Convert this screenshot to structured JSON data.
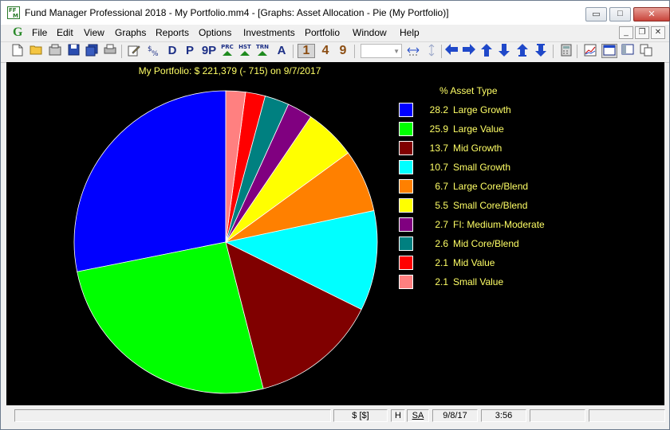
{
  "window": {
    "title": "Fund Manager Professional 2018 - My Portfolio.mm4 - [Graphs: Asset Allocation - Pie (My Portfolio)]",
    "icon_text_top": "FF",
    "icon_text_bottom": "M",
    "minimize_glyph": "▭",
    "maximize_glyph": "□",
    "close_glyph": "✕"
  },
  "menu": {
    "logo": "G",
    "items": [
      "File",
      "Edit",
      "View",
      "Graphs",
      "Reports",
      "Options",
      "Investments",
      "Portfolio",
      "Window",
      "Help"
    ],
    "mdi_minimize": "_",
    "mdi_restore": "❐",
    "mdi_close": "✕"
  },
  "toolbar": {
    "text_buttons": [
      "D",
      "P",
      "9P"
    ],
    "small_labels": [
      "PRC",
      "HST",
      "TRN"
    ],
    "a_button": "A",
    "period_buttons": [
      "1",
      "4",
      "9"
    ],
    "combo_value": ""
  },
  "chart_data": {
    "type": "pie",
    "title": "My Portfolio: $ 221,379 (- 715) on 9/7/2017",
    "legend_header": "%  Asset Type",
    "slices": [
      {
        "label": "Large Growth",
        "value": 28.2,
        "color": "#0000ff"
      },
      {
        "label": "Large Value",
        "value": 25.9,
        "color": "#00ff00"
      },
      {
        "label": "Mid Growth",
        "value": 13.7,
        "color": "#800000"
      },
      {
        "label": "Small Growth",
        "value": 10.7,
        "color": "#00ffff"
      },
      {
        "label": "Large Core/Blend",
        "value": 6.7,
        "color": "#ff8000"
      },
      {
        "label": "Small Core/Blend",
        "value": 5.5,
        "color": "#ffff00"
      },
      {
        "label": "FI: Medium-Moderate",
        "value": 2.7,
        "color": "#800080"
      },
      {
        "label": "Mid Core/Blend",
        "value": 2.6,
        "color": "#008080"
      },
      {
        "label": "Mid Value",
        "value": 2.1,
        "color": "#ff0000"
      },
      {
        "label": "Small Value",
        "value": 2.1,
        "color": "#ff8080"
      }
    ]
  },
  "status": {
    "currency": "$ [$]",
    "h": "H",
    "sa": "SA",
    "date": "9/8/17",
    "time": "3:56"
  }
}
